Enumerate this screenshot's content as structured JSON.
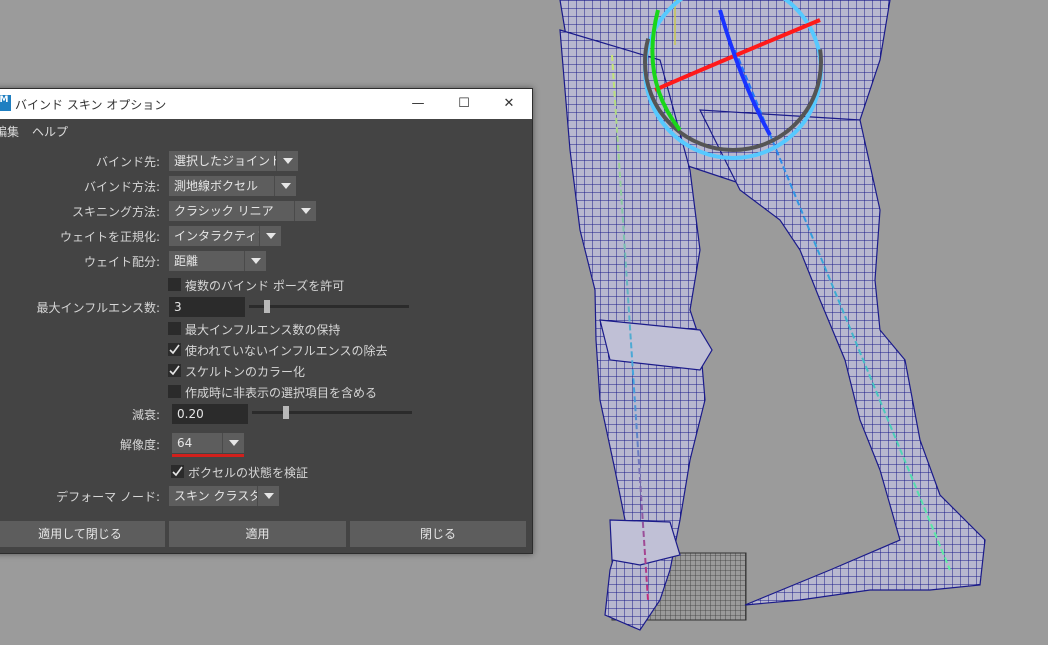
{
  "dialog": {
    "title": "バインド スキン オプション",
    "app_icon_text": "M",
    "window_controls": {
      "minimize": "—",
      "maximize": "☐",
      "close": "✕"
    },
    "menu": [
      "編集",
      "ヘルプ"
    ]
  },
  "options": {
    "bind_to": {
      "label": "バインド先:",
      "value": "選択したジョイント"
    },
    "bind_method": {
      "label": "バインド方法:",
      "value": "測地線ボクセル"
    },
    "skinning_method": {
      "label": "スキニング方法:",
      "value": "クラシック リニア"
    },
    "normalize_weights": {
      "label": "ウェイトを正規化:",
      "value": "インタラクティブ"
    },
    "weight_distribution": {
      "label": "ウェイト配分:",
      "value": "距離"
    },
    "allow_multiple_bind_poses": {
      "label": "複数のバインド ポーズを許可",
      "checked": false
    },
    "max_influences": {
      "label": "最大インフルエンス数:",
      "value": "3",
      "slider_fraction": 0.1
    },
    "maintain_max_influences": {
      "label": "最大インフルエンス数の保持",
      "checked": false
    },
    "remove_unused_influences": {
      "label": "使われていないインフルエンスの除去",
      "checked": true
    },
    "colorize_skeleton": {
      "label": "スケルトンのカラー化",
      "checked": true
    },
    "include_hidden": {
      "label": "作成時に非表示の選択項目を含める",
      "checked": false
    },
    "falloff": {
      "label": "減衰:",
      "value": "0.20",
      "slider_fraction": 0.2
    },
    "resolution": {
      "label": "解像度:",
      "value": "64",
      "highlight_color": "#d2201c"
    },
    "validate_voxel_state": {
      "label": "ボクセルの状態を検証",
      "checked": true
    },
    "deformer_node": {
      "label": "デフォーマ ノード:",
      "value": "スキン クラスタ"
    }
  },
  "buttons": {
    "apply_and_close": "適用して閉じる",
    "apply": "適用",
    "close": "閉じる"
  },
  "colors": {
    "viewport_bg": "#9b9b9b",
    "mesh": "#1b1b8a",
    "bone_gradient_start": "#1e6fff",
    "bone_gradient_end": "#5ff2a0",
    "rotate_x": "#ff1a1a",
    "rotate_y": "#19d619",
    "rotate_z": "#1a33ff",
    "rotate_outer": "#56c9ff"
  }
}
